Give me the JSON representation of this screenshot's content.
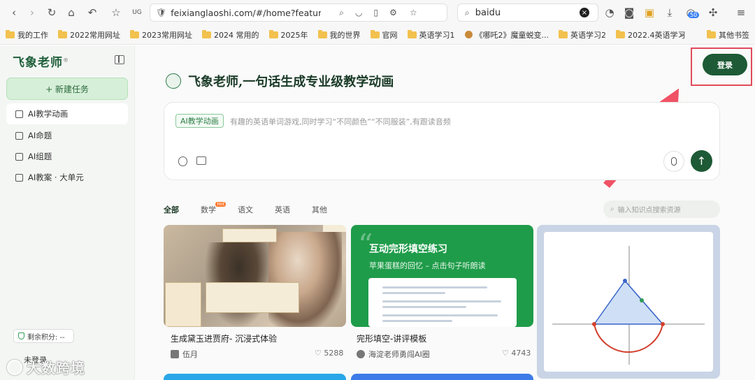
{
  "browser": {
    "url": "feixianglaoshi.com/#/home?feature",
    "search_query": "baidu",
    "ext_badge": "50"
  },
  "bookmarks": [
    "我的工作",
    "2022常用网址",
    "2023常用网址",
    "2024 常用的",
    "2025年",
    "我的世界",
    "官网",
    "英语学习1",
    "《哪吒2》魔童蜕变...",
    "英语学习2",
    "2022.4英语学习"
  ],
  "bookmarks_more": "»",
  "bookmarks_other": "其他书签",
  "sidebar": {
    "logo": "飞象老师",
    "new_task": "+ 新建任务",
    "items": [
      {
        "label": "AI教学动画"
      },
      {
        "label": "AI命题"
      },
      {
        "label": "AI组题"
      },
      {
        "label": "AI教案 · 大单元"
      }
    ],
    "credits": "剩余积分: --",
    "user": "未登录"
  },
  "watermark": "大数跨境",
  "header": {
    "login": "登录",
    "headline": "飞象老师,一句话生成专业级教学动画"
  },
  "prompt": {
    "tag": "AI教学动画",
    "placeholder": "有趣的英语单词游戏,同时学习“不同颜色”“不同服装”,有跟读音频"
  },
  "tabs": [
    {
      "label": "全部",
      "active": true
    },
    {
      "label": "数学",
      "badge": "Hot"
    },
    {
      "label": "语文"
    },
    {
      "label": "英语"
    },
    {
      "label": "其他"
    }
  ],
  "kw_search_placeholder": "输入知识点搜索资源",
  "cards": [
    {
      "title": "生成黛玉进贾府- 沉浸式体验",
      "author": "伍月",
      "likes": "5288"
    },
    {
      "title": "完形填空-讲评模板",
      "author": "海淀老师勇闯AI圈",
      "likes": "4743",
      "banner_title": "互动完形填空练习",
      "banner_sub": "苹果蛋糕的回忆 – 点击句子听朗读"
    }
  ],
  "colors": {
    "brand": "#1d5a35",
    "accent_green": "#1f9c4a",
    "highlight_red": "#e24b5c"
  }
}
